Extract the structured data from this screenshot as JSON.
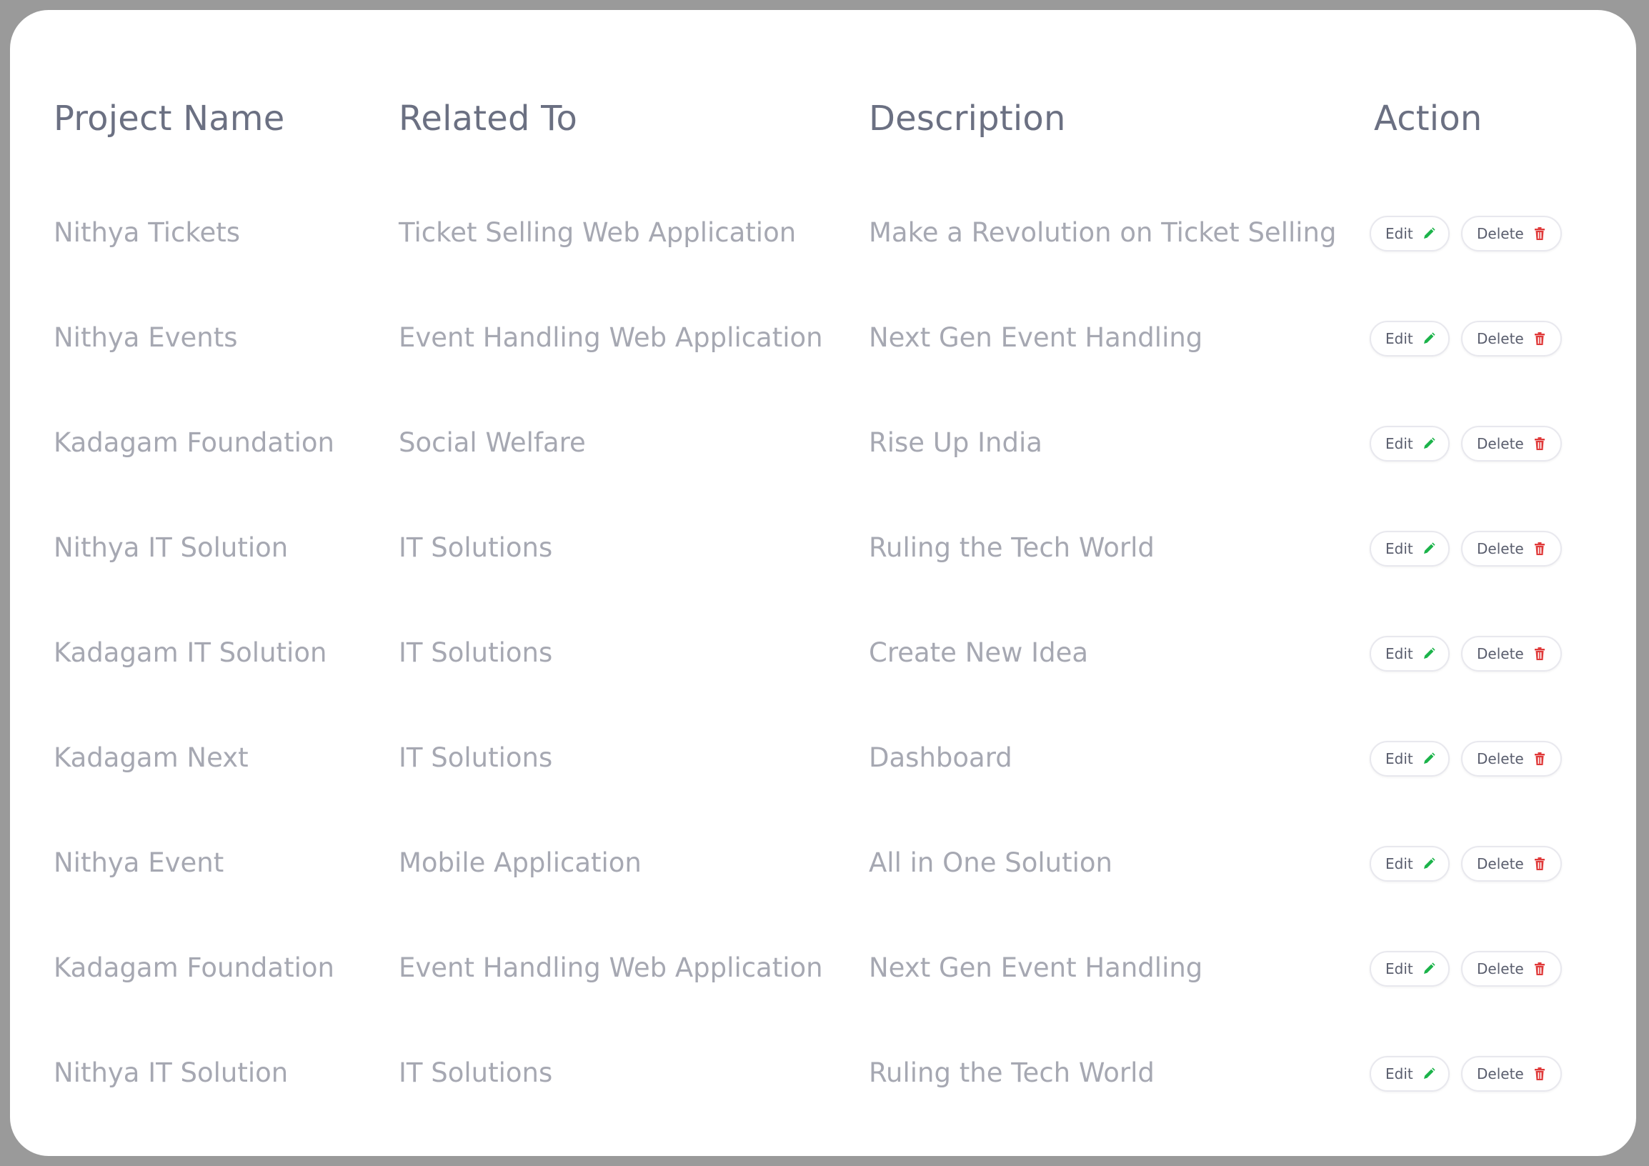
{
  "headers": {
    "project_name": "Project Name",
    "related_to": "Related To",
    "description": "Description",
    "action": "Action"
  },
  "buttons": {
    "edit_label": "Edit",
    "delete_label": "Delete",
    "edit_icon": "pencil-icon",
    "delete_icon": "trash-icon",
    "edit_icon_color": "#1bb34a",
    "delete_icon_color": "#e03a3a"
  },
  "rows": [
    {
      "project_name": "Nithya Tickets",
      "related_to": "Ticket Selling Web Application",
      "description": "Make a Revolution on Ticket Selling"
    },
    {
      "project_name": "Nithya Events",
      "related_to": "Event Handling Web Application",
      "description": "Next Gen Event Handling"
    },
    {
      "project_name": "Kadagam Foundation",
      "related_to": "Social Welfare",
      "description": "Rise Up India"
    },
    {
      "project_name": "Nithya IT Solution",
      "related_to": "IT Solutions",
      "description": "Ruling the Tech World"
    },
    {
      "project_name": "Kadagam IT Solution",
      "related_to": "IT Solutions",
      "description": "Create New Idea"
    },
    {
      "project_name": "Kadagam Next",
      "related_to": "IT Solutions",
      "description": "Dashboard"
    },
    {
      "project_name": "Nithya Event",
      "related_to": "Mobile Application",
      "description": "All in One Solution"
    },
    {
      "project_name": "Kadagam Foundation",
      "related_to": "Event Handling Web Application",
      "description": "Next Gen Event Handling"
    },
    {
      "project_name": "Nithya IT Solution",
      "related_to": "IT Solutions",
      "description": "Ruling the Tech World"
    }
  ]
}
